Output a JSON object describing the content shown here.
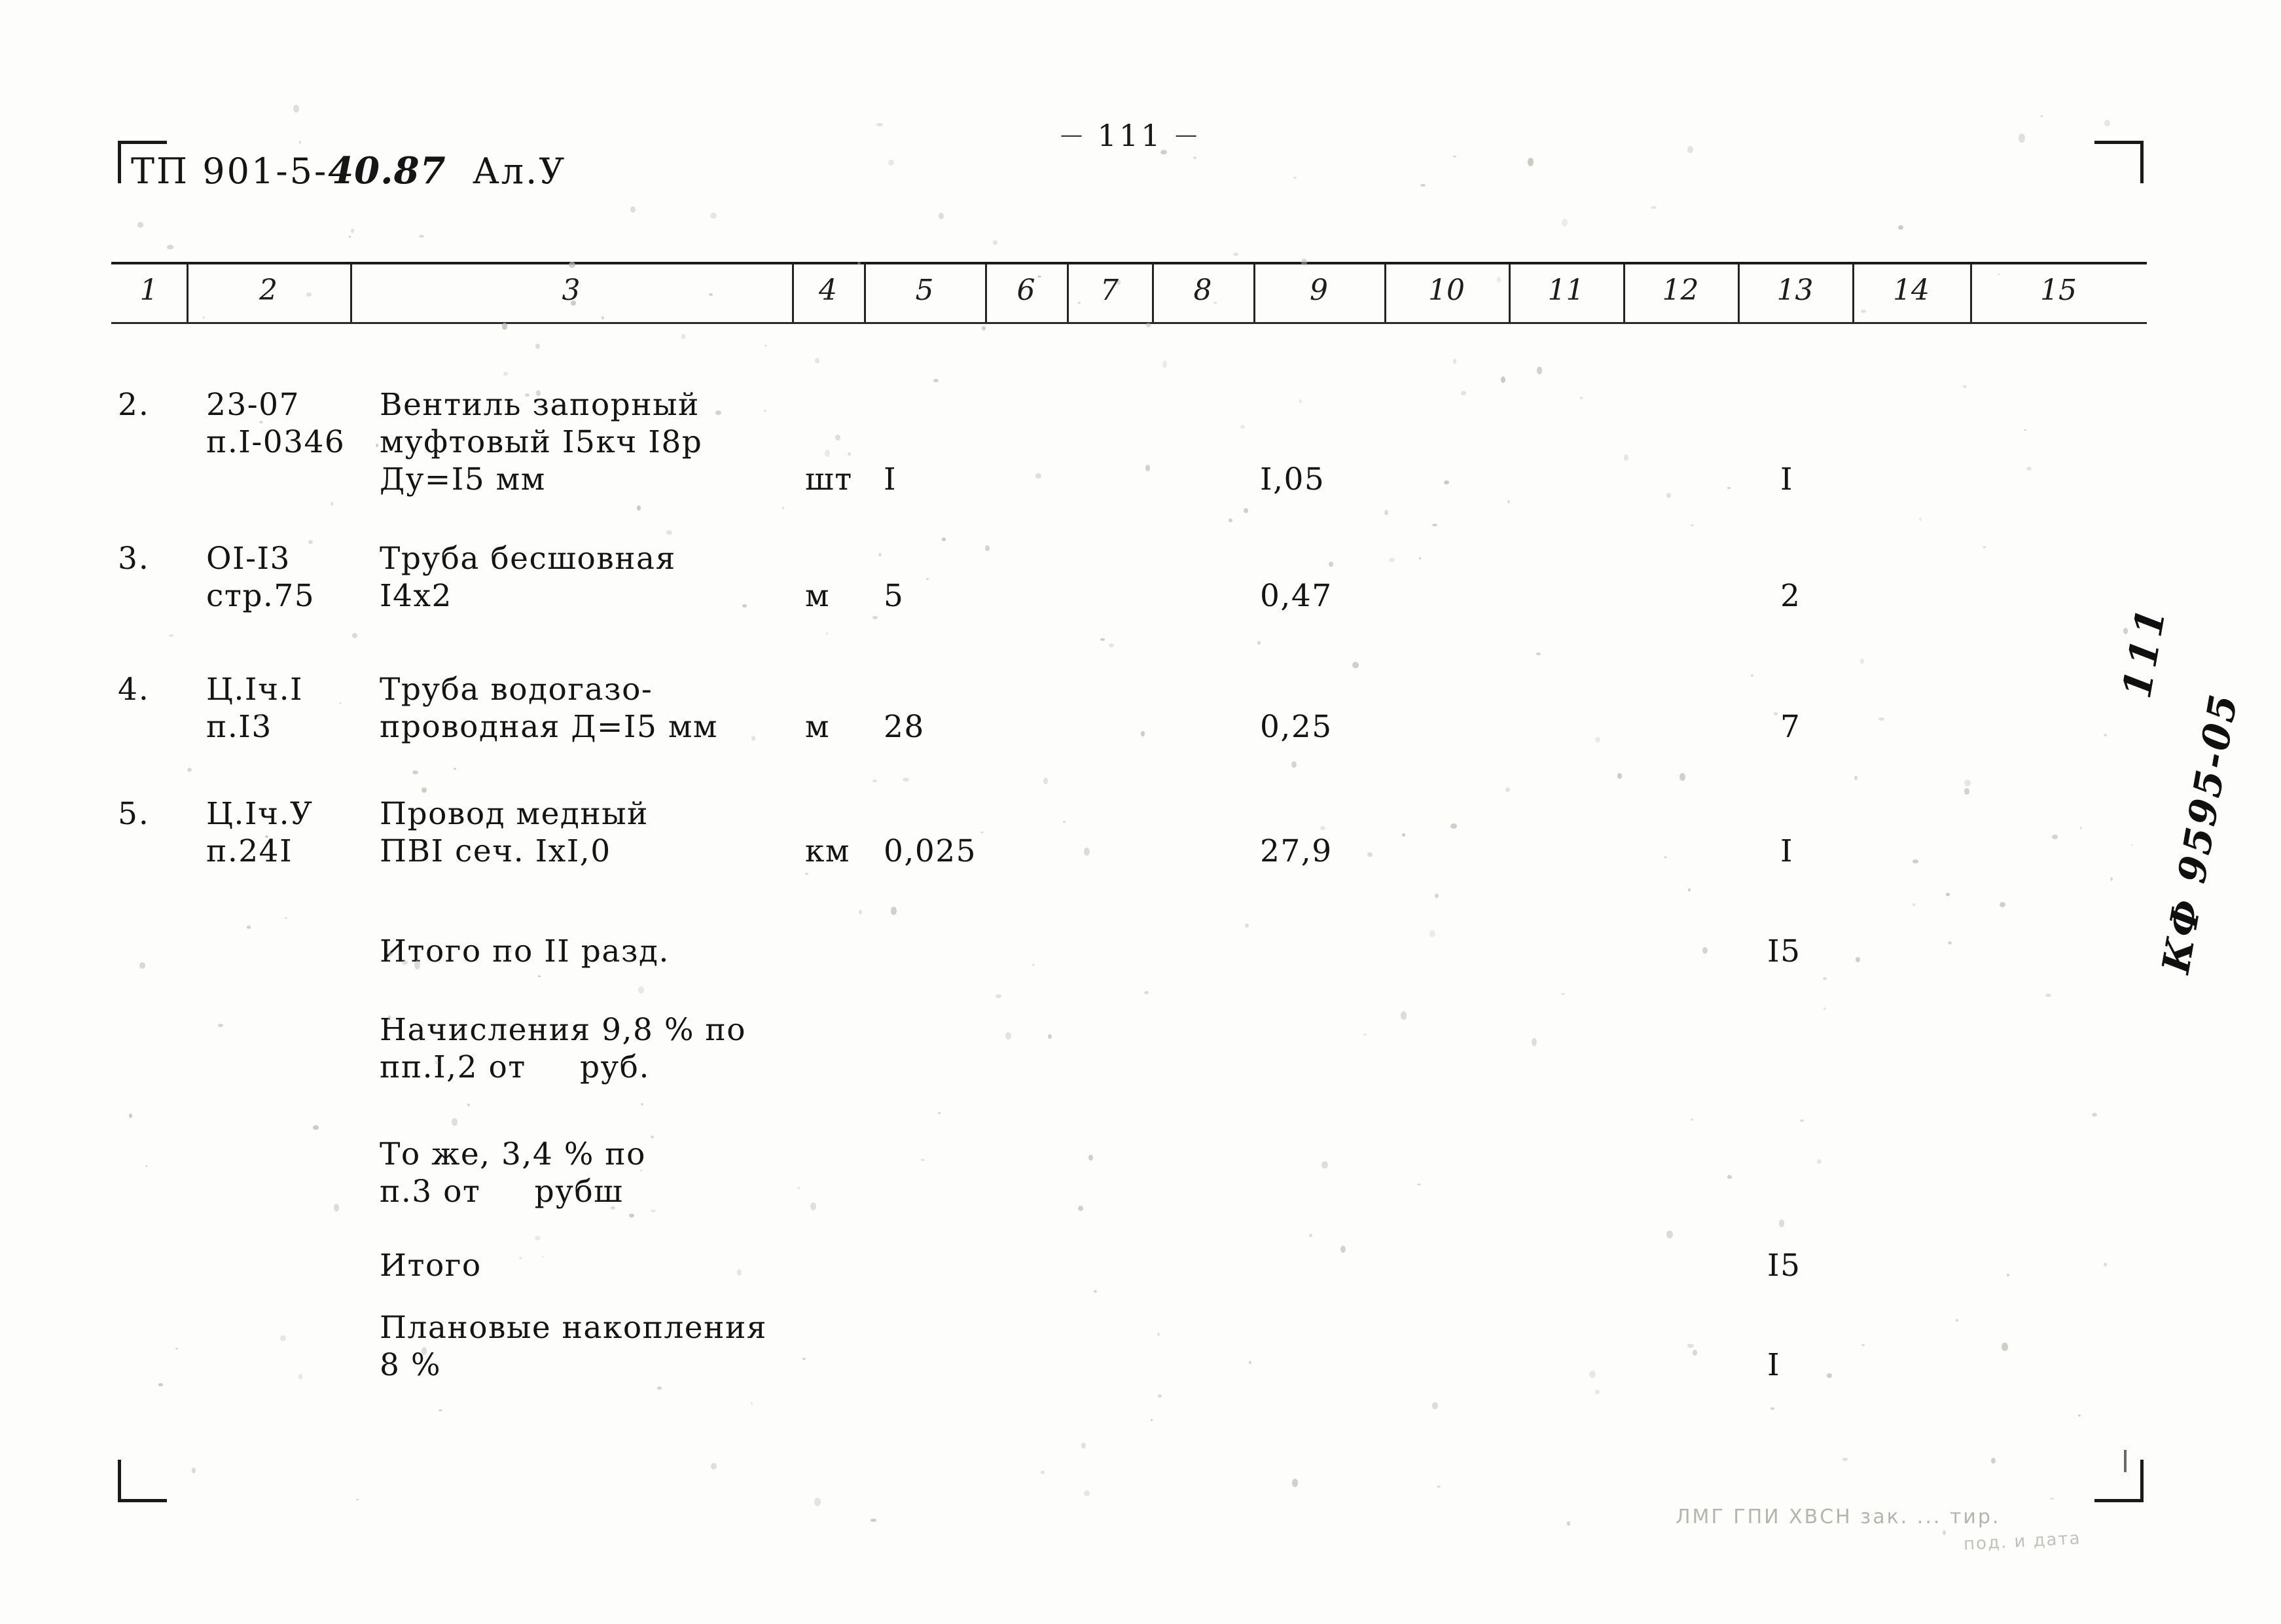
{
  "header": {
    "doc_code_prefix": "ТП 901-5-",
    "doc_code_stamped": "40.87",
    "doc_code_suffix": "Ал.У",
    "page_number": "111",
    "dash_left": "—",
    "dash_right": "—"
  },
  "table": {
    "column_numbers": [
      "1",
      "2",
      "3",
      "4",
      "5",
      "6",
      "7",
      "8",
      "9",
      "10",
      "11",
      "12",
      "13",
      "14",
      "15"
    ],
    "rows": [
      {
        "c1": "2.",
        "c2": "23-07\nп.I-0346",
        "c3": "Вентиль запорный\nмуфтовый I5кч I8р\nДу=I5 мм",
        "c4": "шт",
        "c5": "I",
        "c9": "I,05",
        "c13": "I"
      },
      {
        "c1": "3.",
        "c2": "OI-I3\nстр.75",
        "c3": "Труба бесшовная\nI4x2",
        "c4": "м",
        "c5": "5",
        "c9": "0,47",
        "c13": "2"
      },
      {
        "c1": "4.",
        "c2": "Ц.Iч.I\nп.I3",
        "c3": "Труба водогазо-\nпроводная Д=I5 мм",
        "c4": "м",
        "c5": "28",
        "c9": "0,25",
        "c13": "7"
      },
      {
        "c1": "5.",
        "c2": "Ц.Iч.У\nп.24I",
        "c3": "Провод медный\nПВI сеч. IxI,0",
        "c4": "км",
        "c5": "0,025",
        "c9": "27,9",
        "c13": "I"
      }
    ],
    "summary_rows": [
      {
        "label": "Итого по II разд.",
        "c13": "I5"
      },
      {
        "label": "Начисления 9,8 % по\nпп.I,2 от     руб.",
        "c13": ""
      },
      {
        "label": "То же, 3,4 % по\nп.3 от     рубш",
        "c13": ""
      },
      {
        "label": "Итого",
        "c13": "I5"
      },
      {
        "label": "Плановые накопления\n8 %",
        "c13": "I"
      }
    ]
  },
  "marginalia": {
    "page_number_handwritten": "111",
    "archive_code": "КФ 9595-05"
  },
  "footer": {
    "stamp_text": "ЛМГ ГПИ ХВСН   зак. ... тир.",
    "stamp_text_2": "под. и дата"
  }
}
